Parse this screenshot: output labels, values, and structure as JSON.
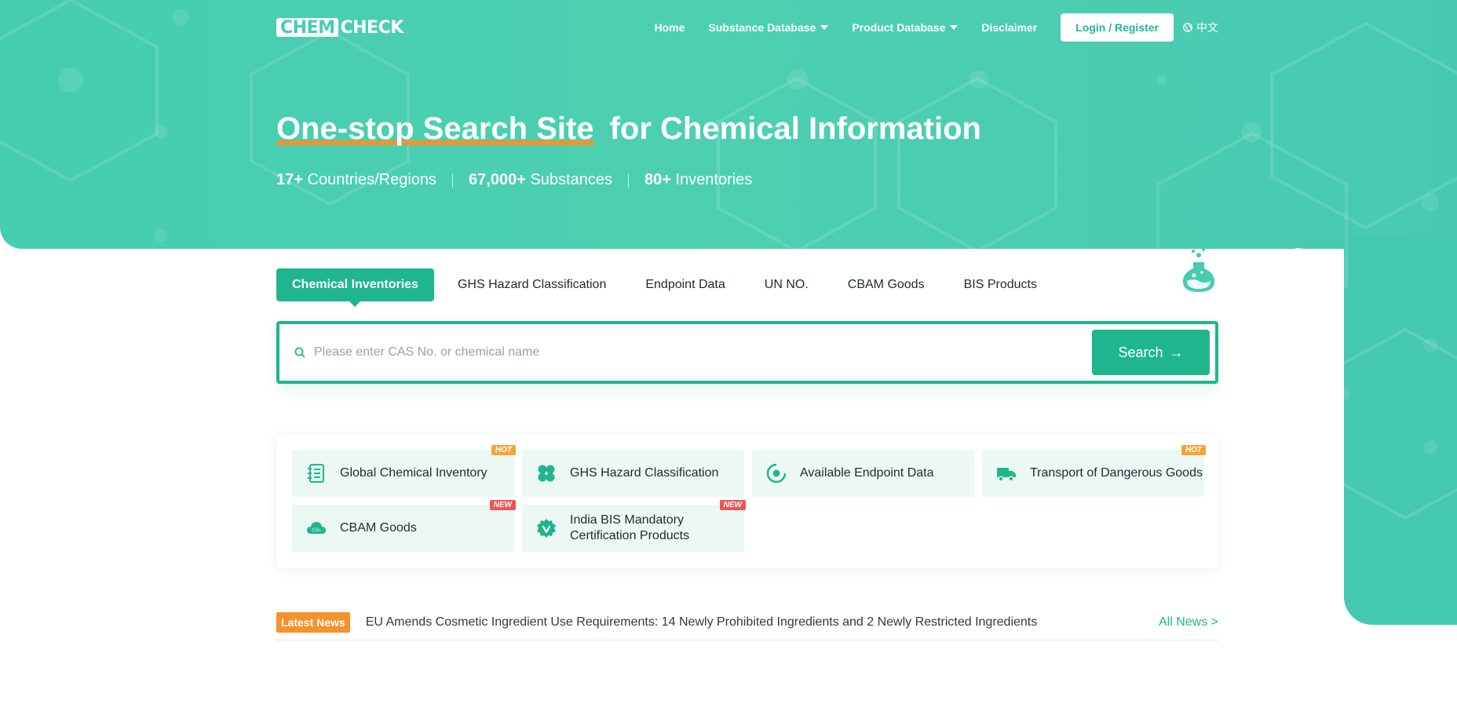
{
  "brand": {
    "logo_part1": "CHEM",
    "logo_part2": "CHECK"
  },
  "nav": {
    "items": [
      {
        "label": "Home"
      },
      {
        "label": "Substance Database",
        "dropdown": true
      },
      {
        "label": "Product Database",
        "dropdown": true
      },
      {
        "label": "Disclaimer"
      }
    ],
    "login_label": "Login / Register",
    "language_label": "中文"
  },
  "hero": {
    "title_highlight": "One-stop Search Site",
    "title_rest": "for Chemical Information",
    "stats": [
      {
        "number": "17+",
        "label": "Countries/Regions"
      },
      {
        "number": "67,000+",
        "label": "Substances"
      },
      {
        "number": "80+",
        "label": "Inventories"
      }
    ]
  },
  "tabs": [
    {
      "label": "Chemical Inventories",
      "active": true
    },
    {
      "label": "GHS Hazard Classification",
      "active": false
    },
    {
      "label": "Endpoint Data",
      "active": false
    },
    {
      "label": "UN NO.",
      "active": false
    },
    {
      "label": "CBAM Goods",
      "active": false
    },
    {
      "label": "BIS Products",
      "active": false
    }
  ],
  "search": {
    "placeholder": "Please enter CAS No. or chemical name",
    "value": "",
    "button_label": "Search",
    "button_arrow": "→"
  },
  "quick_links": [
    {
      "label": "Global Chemical Inventory",
      "icon": "notebook-icon",
      "badge": "HOT"
    },
    {
      "label": "GHS Hazard Classification",
      "icon": "clover-icon",
      "badge": ""
    },
    {
      "label": "Available Endpoint Data",
      "icon": "target-icon",
      "badge": ""
    },
    {
      "label": "Transport of Dangerous Goods",
      "icon": "truck-icon",
      "badge": "HOT"
    },
    {
      "label": "CBAM Goods",
      "icon": "co2-cloud-icon",
      "badge": "NEW"
    },
    {
      "label": "India BIS Mandatory Certification Products",
      "icon": "verified-badge-icon",
      "badge": "NEW"
    }
  ],
  "news": {
    "tag": "Latest News",
    "headline": "EU Amends Cosmetic Ingredient Use Requirements: 14 Newly Prohibited Ingredients and 2 Newly Restricted Ingredients",
    "all_label": "All News >"
  },
  "colors": {
    "primary": "#1fb68e",
    "hero_teal": "#45cdb0",
    "accent_orange": "#f5922c",
    "badge_hot": "#f5a43a",
    "badge_new": "#f05454",
    "tile_bg": "#ebf8f4"
  }
}
